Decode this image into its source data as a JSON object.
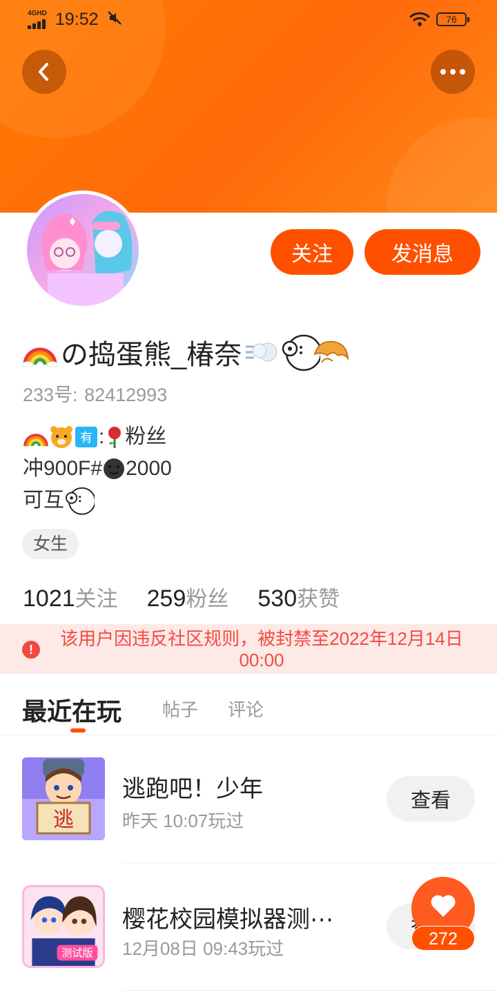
{
  "status_bar": {
    "network": "4GHD",
    "time": "19:52",
    "battery": "76",
    "icons": [
      "signal-icon",
      "silent-icon",
      "wifi-icon",
      "battery-icon"
    ]
  },
  "nav": {
    "back_icon": "chevron-left-icon",
    "more_icon": "more-dots-icon"
  },
  "profile": {
    "nickname": "の捣蛋熊_椿奈",
    "id_label": "233号:",
    "id_value": "82412993",
    "bio": {
      "line1_text_a": ":",
      "line1_text_b": "粉丝",
      "line2_prefix": "冲900F#",
      "line2_suffix": "2000",
      "line3": "可互"
    },
    "tag": "女生"
  },
  "actions": {
    "follow": "关注",
    "message": "发消息"
  },
  "stats": {
    "following_num": "1021",
    "following_label": "关注",
    "fans_num": "259",
    "fans_label": "粉丝",
    "likes_num": "530",
    "likes_label": "获赞"
  },
  "ban_notice": {
    "text": "该用户因违反社区规则，被封禁至2022年12月14日 00:00",
    "icon": "warning-icon"
  },
  "tabs": {
    "recent": "最近在玩",
    "posts": "帖子",
    "comments": "评论"
  },
  "games": [
    {
      "title": "逃跑吧！少年",
      "time": "昨天 10:07玩过",
      "button": "查看",
      "sign": "逃"
    },
    {
      "title": "樱花校园模拟器测⋯",
      "time": "12月08日 09:43玩过",
      "button": "查看",
      "badge": "测试版"
    }
  ],
  "fab": {
    "icon": "heart-icon",
    "count": "272"
  },
  "colors": {
    "accent": "#ff5000",
    "header": "#ff7a00",
    "ban_bg": "#fde9e6",
    "ban_text": "#f24a41"
  }
}
